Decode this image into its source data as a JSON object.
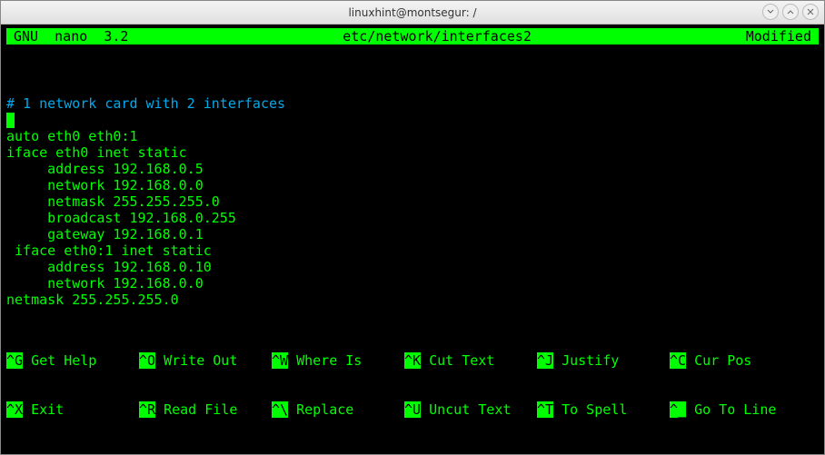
{
  "window": {
    "title": "linuxhint@montsegur: /"
  },
  "nano": {
    "version": "GNU  nano  3.2",
    "filepath": "etc/network/interfaces2",
    "status": "Modified"
  },
  "editor": {
    "comment": "# 1 network card with 2 interfaces",
    "lines": [
      "auto eth0 eth0:1",
      "iface eth0 inet static",
      "     address 192.168.0.5",
      "     network 192.168.0.0",
      "     netmask 255.255.255.0",
      "     broadcast 192.168.0.255",
      "     gateway 192.168.0.1",
      " iface eth0:1 inet static",
      "     address 192.168.0.10",
      "     network 192.168.0.0",
      "netmask 255.255.255.0"
    ]
  },
  "shortcuts": {
    "row1": [
      {
        "key": "^G",
        "label": " Get Help"
      },
      {
        "key": "^O",
        "label": " Write Out"
      },
      {
        "key": "^W",
        "label": " Where Is"
      },
      {
        "key": "^K",
        "label": " Cut Text"
      },
      {
        "key": "^J",
        "label": " Justify"
      },
      {
        "key": "^C",
        "label": " Cur Pos"
      }
    ],
    "row2": [
      {
        "key": "^X",
        "label": " Exit"
      },
      {
        "key": "^R",
        "label": " Read File"
      },
      {
        "key": "^\\",
        "label": " Replace"
      },
      {
        "key": "^U",
        "label": " Uncut Text"
      },
      {
        "key": "^T",
        "label": " To Spell"
      },
      {
        "key": "^_",
        "label": " Go To Line"
      }
    ]
  }
}
